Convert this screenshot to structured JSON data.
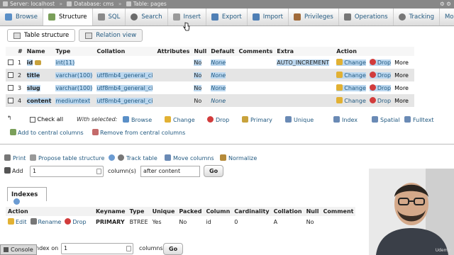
{
  "breadcrumb": {
    "server": "Server: localhost",
    "database": "Database: cms",
    "table": "Table: pages",
    "right_icons": "⚙ ⚙"
  },
  "tabs": [
    "Browse",
    "Structure",
    "SQL",
    "Search",
    "Insert",
    "Export",
    "Import",
    "Privileges",
    "Operations",
    "Tracking",
    "Mor"
  ],
  "active_tab": "Structure",
  "subtabs": [
    "Table structure",
    "Relation view"
  ],
  "columns": [
    "#",
    "Name",
    "Type",
    "Collation",
    "Attributes",
    "Null",
    "Default",
    "Comments",
    "Extra",
    "Action"
  ],
  "rows": [
    {
      "num": "1",
      "name": "id",
      "type": "int(11)",
      "collation": "",
      "attributes": "",
      "null": "No",
      "default": "None",
      "comments": "",
      "extra": "AUTO_INCREMENT"
    },
    {
      "num": "2",
      "name": "title",
      "type": "varchar(100)",
      "collation": "utf8mb4_general_ci",
      "attributes": "",
      "null": "No",
      "default": "None",
      "comments": "",
      "extra": ""
    },
    {
      "num": "3",
      "name": "slug",
      "type": "varchar(100)",
      "collation": "utf8mb4_general_ci",
      "attributes": "",
      "null": "No",
      "default": "None",
      "comments": "",
      "extra": ""
    },
    {
      "num": "4",
      "name": "content",
      "type": "mediumtext",
      "collation": "utf8mb4_general_ci",
      "attributes": "",
      "null": "No",
      "default": "None",
      "comments": "",
      "extra": ""
    }
  ],
  "row_actions": {
    "change": "Change",
    "drop": "Drop",
    "more": "More"
  },
  "with_selected": {
    "check_all": "Check all",
    "label": "With selected:",
    "items": [
      "Browse",
      "Change",
      "Drop",
      "Primary",
      "Unique",
      "Index",
      "Spatial",
      "Fulltext"
    ],
    "add_central": "Add to central columns",
    "remove_central": "Remove from central columns"
  },
  "table_actions": {
    "print": "Print",
    "propose": "Propose table structure",
    "track": "Track table",
    "move": "Move columns",
    "normalize": "Normalize"
  },
  "add_columns": {
    "label": "Add",
    "value": "1",
    "unit": "column(s)",
    "position": "after content",
    "go": "Go"
  },
  "indexes": {
    "title": "Indexes",
    "columns": [
      "Action",
      "Keyname",
      "Type",
      "Unique",
      "Packed",
      "Column",
      "Cardinality",
      "Collation",
      "Null",
      "Comment"
    ],
    "row": {
      "edit": "Edit",
      "rename": "Rename",
      "drop": "Drop",
      "keyname": "PRIMARY",
      "type": "BTREE",
      "unique": "Yes",
      "packed": "No",
      "column": "id",
      "cardinality": "0",
      "collation": "A",
      "null": "No",
      "comment": ""
    }
  },
  "create_index": {
    "label": "ndex on",
    "value": "1",
    "unit": "columns",
    "go": "Go"
  },
  "console": "Console",
  "watermark": "Udemy"
}
